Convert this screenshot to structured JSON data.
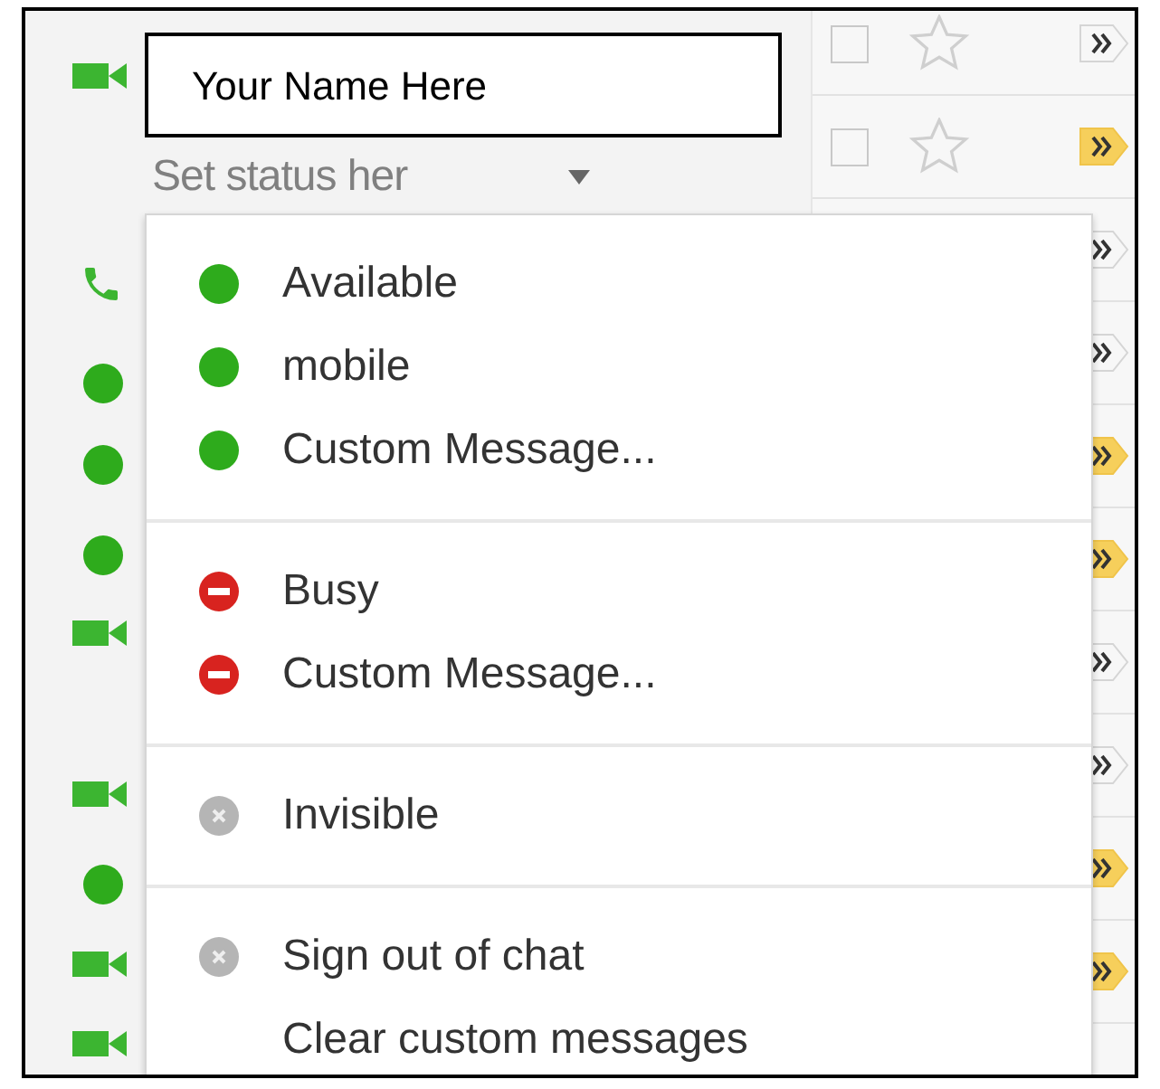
{
  "profile": {
    "name": "Your Name Here",
    "status_placeholder": "Set status her"
  },
  "status_menu": {
    "groups": [
      {
        "items": [
          {
            "kind": "available",
            "label": "Available"
          },
          {
            "kind": "available",
            "label": "mobile"
          },
          {
            "kind": "available",
            "label": "Custom Message..."
          }
        ]
      },
      {
        "items": [
          {
            "kind": "busy",
            "label": "Busy"
          },
          {
            "kind": "busy",
            "label": "Custom Message..."
          }
        ]
      },
      {
        "items": [
          {
            "kind": "offline",
            "label": "Invisible"
          }
        ]
      },
      {
        "items": [
          {
            "kind": "offline",
            "label": "Sign out of chat"
          },
          {
            "kind": "plain",
            "label": "Clear custom messages"
          }
        ]
      }
    ]
  },
  "mail_rows": [
    {
      "checked": false,
      "important": false
    },
    {
      "checked": false,
      "important": true
    },
    {
      "important": false
    },
    {
      "important": false
    },
    {
      "important": true
    },
    {
      "important": true
    },
    {
      "important": false
    },
    {
      "important": false
    },
    {
      "important": true
    },
    {
      "important": true
    }
  ]
}
